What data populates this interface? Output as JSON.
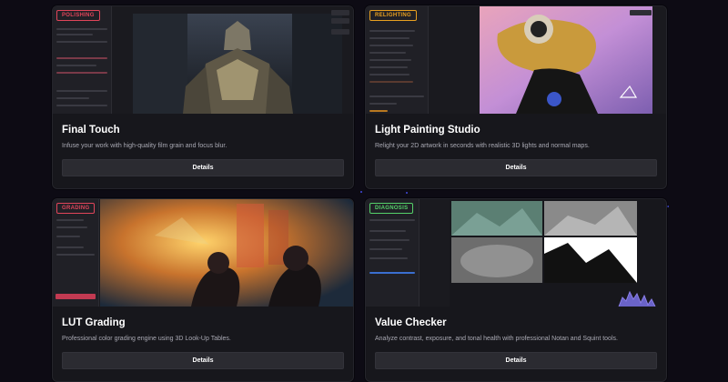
{
  "cards": [
    {
      "tool_label": "POLISHING",
      "title": "Final Touch",
      "description": "Infuse your work with high-quality film grain and focus blur.",
      "button_label": "Details",
      "accent": "#e0455a"
    },
    {
      "tool_label": "RELIGHTING",
      "title": "Light Painting Studio",
      "description": "Relight your 2D artwork in seconds with realistic 3D lights and normal maps.",
      "button_label": "Details",
      "accent": "#e8a020"
    },
    {
      "tool_label": "GRADING",
      "title": "LUT Grading",
      "description": "Professional color grading engine using 3D Look-Up Tables.",
      "button_label": "Details",
      "accent": "#e0455a"
    },
    {
      "tool_label": "DIAGNOSIS",
      "title": "Value Checker",
      "description": "Analyze contrast, exposure, and tonal health with professional Notan and Squint tools.",
      "button_label": "Details",
      "accent": "#55d06a"
    }
  ],
  "colors": {
    "background": "#0d0b14",
    "card": "#17171c",
    "button": "#2b2b31",
    "star": "#4a55ff"
  }
}
